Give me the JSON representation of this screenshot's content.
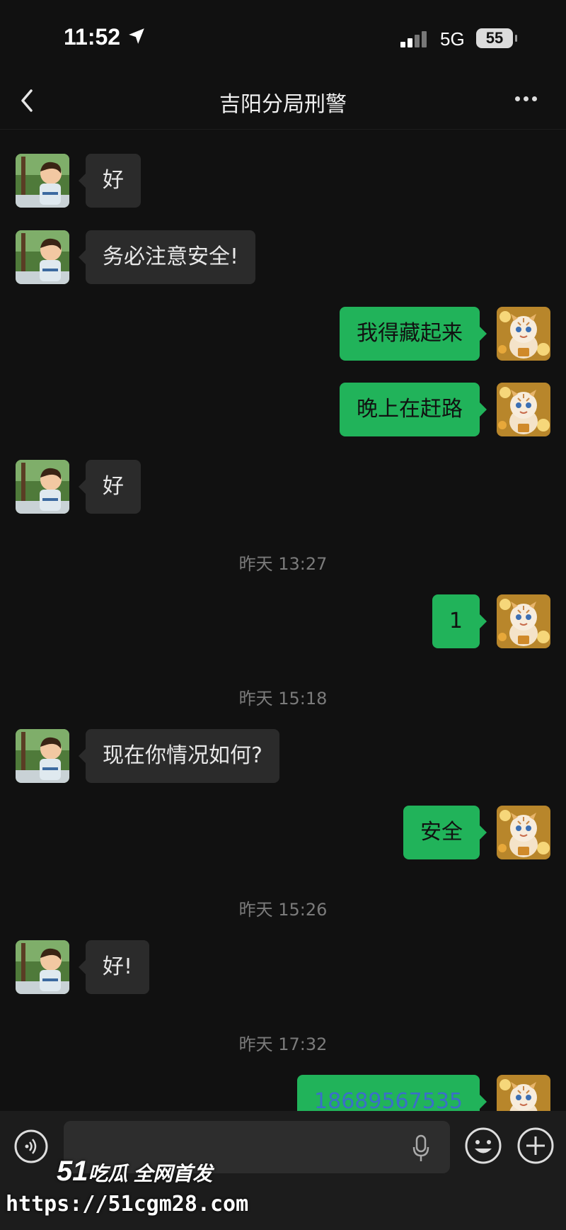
{
  "status_bar": {
    "time": "11:52",
    "network": "5G",
    "battery": "55"
  },
  "header": {
    "title": "吉阳分局刑警"
  },
  "messages": [
    {
      "side": "in",
      "text": "好"
    },
    {
      "side": "in",
      "text": "务必注意安全!"
    },
    {
      "side": "out",
      "text": "我得藏起来"
    },
    {
      "side": "out",
      "text": "晚上在赶路"
    },
    {
      "side": "in",
      "text": "好"
    },
    {
      "side": "out",
      "text": "1"
    },
    {
      "side": "in",
      "text": "现在你情况如何?"
    },
    {
      "side": "out",
      "text": "安全"
    },
    {
      "side": "in",
      "text": "好!"
    },
    {
      "side": "out",
      "text": "18689567535"
    }
  ],
  "timestamps": [
    "昨天 13:27",
    "昨天 15:18",
    "昨天 15:26",
    "昨天 17:32"
  ],
  "watermark": {
    "brand_num": "51",
    "brand_text": "吃瓜 全网首发",
    "url": "https://51cgm28.com"
  },
  "icons": [
    "back-arrow-icon",
    "more-icon",
    "location-arrow-icon",
    "signal-icon",
    "voice-icon",
    "microphone-icon",
    "emoji-icon",
    "plus-icon"
  ],
  "colors": {
    "background": "#111111",
    "incoming_bubble": "#2b2b2b",
    "outgoing_bubble": "#21b35a",
    "link": "#3b6ec9"
  }
}
